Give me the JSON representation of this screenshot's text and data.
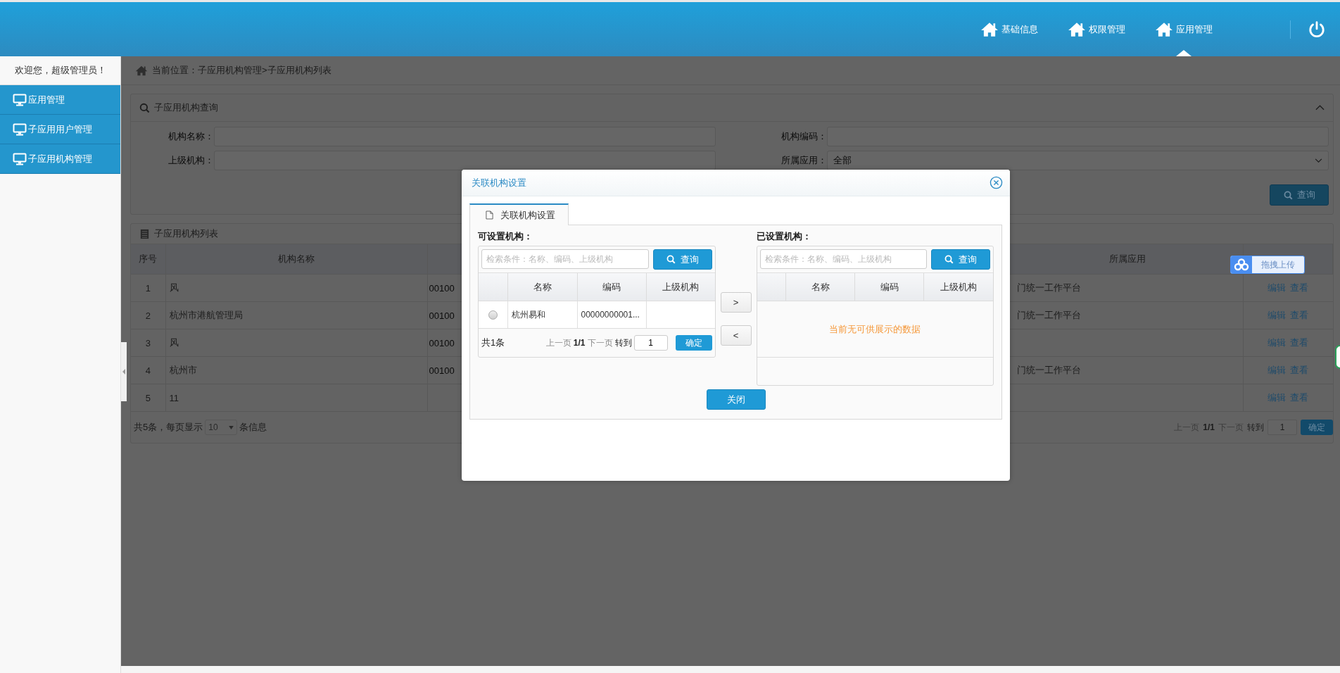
{
  "header": {
    "nav": [
      {
        "label": "基础信息",
        "selected": false
      },
      {
        "label": "权限管理",
        "selected": false
      },
      {
        "label": "应用管理",
        "selected": true
      }
    ]
  },
  "sidebar": {
    "welcome": "欢迎您，超级管理员！",
    "items": [
      {
        "label": "应用管理"
      },
      {
        "label": "子应用用户管理"
      },
      {
        "label": "子应用机构管理"
      }
    ]
  },
  "breadcrumb": "当前位置：子应用机构管理>子应用机构列表",
  "query_panel": {
    "title": "子应用机构查询",
    "fields": [
      {
        "label": "机构名称：",
        "kind": "text"
      },
      {
        "label": "机构编码：",
        "kind": "text"
      },
      {
        "label": "上级机构：",
        "kind": "text"
      },
      {
        "label": "所属应用：",
        "kind": "select",
        "value": "全部"
      }
    ],
    "button": "查询"
  },
  "list_panel": {
    "title": "子应用机构列表",
    "columns": {
      "index": "序号",
      "name": "机构名称",
      "app": "所属应用"
    },
    "rows": [
      {
        "index": "1",
        "name": "风",
        "column_3": "00100",
        "app": "门统一工作平台",
        "actions": [
          "编辑",
          "查看"
        ]
      },
      {
        "index": "2",
        "name": "杭州市港航管理局",
        "column_3": "00100",
        "app": "门统一工作平台",
        "actions": [
          "编辑",
          "查看"
        ]
      },
      {
        "index": "3",
        "name": "风",
        "column_3": "00100",
        "actions": [
          "编辑",
          "查看"
        ]
      },
      {
        "index": "4",
        "name": "杭州市",
        "column_3": "00100",
        "app": "门统一工作平台",
        "actions": [
          "编辑",
          "查看"
        ]
      },
      {
        "index": "5",
        "name": "11",
        "actions": [
          "编辑",
          "查看"
        ]
      }
    ],
    "pagination": {
      "prefix": "共5条，每页显示",
      "page_size": "10",
      "suffix": "条信息",
      "prev": "上一页",
      "page": "1/1",
      "next": "下一页",
      "goto": "转到",
      "goto_value": "1",
      "confirm": "确定"
    }
  },
  "upload_badge": "拖拽上传",
  "dialog": {
    "title": "关联机构设置",
    "tabs": [
      {
        "label": "关联机构设置",
        "selected": true
      }
    ],
    "available": {
      "title": "可设置机构：",
      "search_placeholder": "检索条件：名称、编码、上级机构",
      "search_button": "查询",
      "columns": [
        "名称",
        "编码",
        "上级机构"
      ],
      "rows": [
        {
          "selected": false,
          "name": "杭州易和",
          "code": "00000000001..."
        }
      ],
      "pagination": {
        "total": "共1条",
        "prev": "上一页",
        "page": "1/1",
        "next": "下一页",
        "goto": "转到",
        "goto_value": "1",
        "confirm": "确定"
      }
    },
    "move_buttons": [
      ">",
      "<"
    ],
    "assigned": {
      "title": "已设置机构：",
      "search_placeholder": "检索条件：名称、编码、上级机构",
      "search_button": "查询",
      "columns": [
        "名称",
        "编码",
        "上级机构"
      ],
      "empty_text": "当前无可供展示的数据"
    },
    "close_button": "关闭"
  }
}
